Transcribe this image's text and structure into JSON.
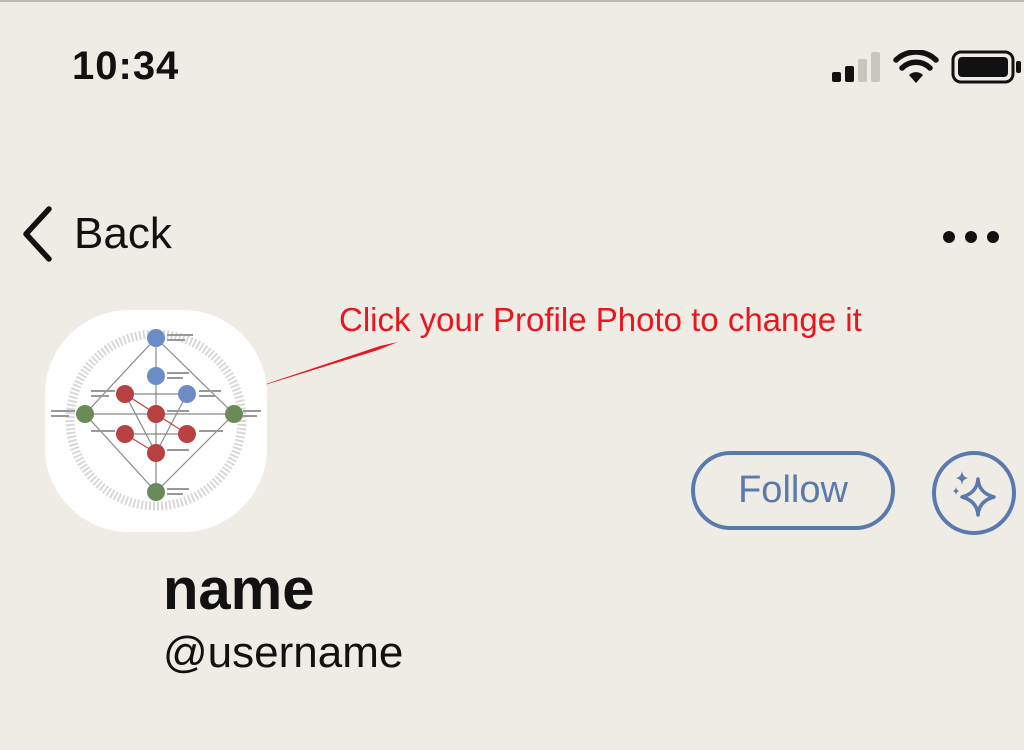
{
  "status_bar": {
    "time": "10:34",
    "signal_icon": "cellular-signal-icon",
    "wifi_icon": "wifi-icon",
    "battery_icon": "battery-icon"
  },
  "nav": {
    "back_label": "Back",
    "back_icon": "chevron-left-icon",
    "more_icon": "ellipsis-icon"
  },
  "annotation": {
    "text": "Click your Profile Photo to change it",
    "color": "#e8161e"
  },
  "profile": {
    "name": "name",
    "username": "@username",
    "follow_label": "Follow",
    "sparkle_icon": "sparkle-icon"
  },
  "colors": {
    "background": "#efece5",
    "accent": "#5a79ad",
    "annotation": "#e8161e"
  }
}
